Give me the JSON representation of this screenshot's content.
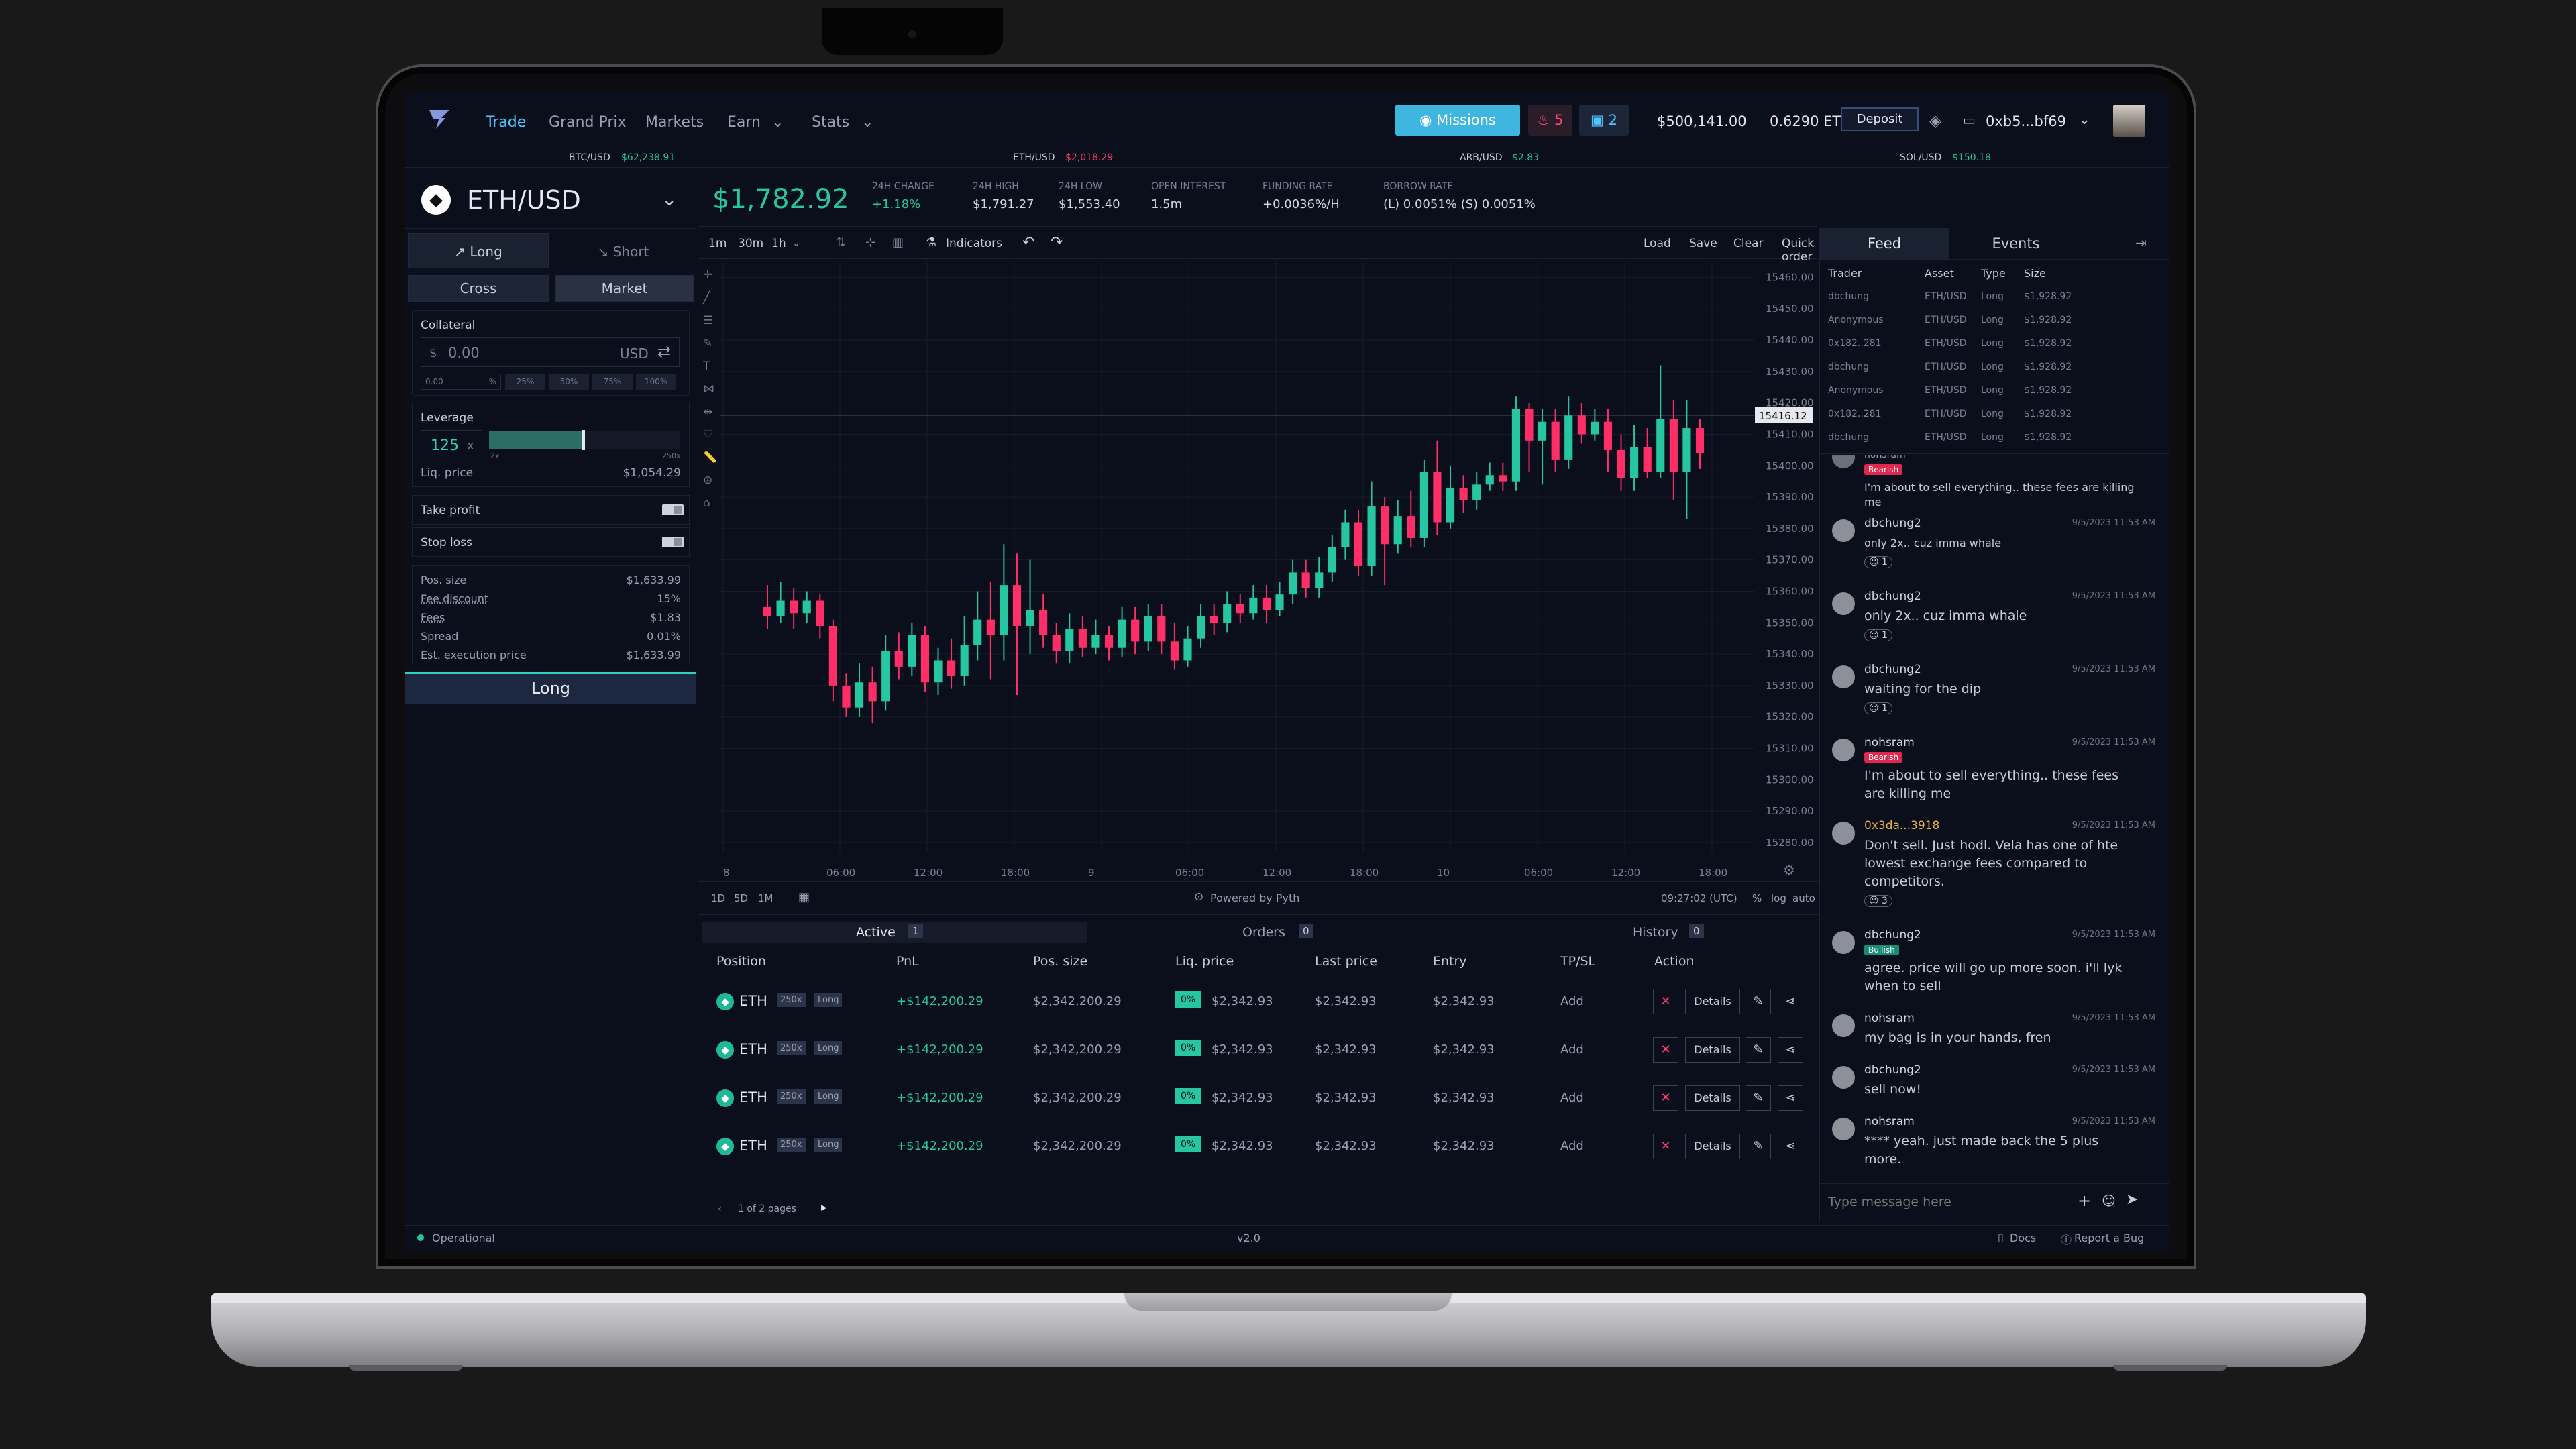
{
  "nav": {
    "links": [
      "Trade",
      "Grand Prix",
      "Markets",
      "Earn",
      "Stats"
    ],
    "missions_label": "Missions",
    "fire_count": "5",
    "box_count": "2",
    "balance_usd": "$500,141.00",
    "balance_eth": "0.6290 ETH",
    "deposit_label": "Deposit",
    "wallet": "0xb5...bf69"
  },
  "ticker": [
    {
      "pair": "BTC/USD",
      "price": "$62,238.91",
      "color": "#26c6a0"
    },
    {
      "pair": "ETH/USD",
      "price": "$2,018.29",
      "color": "#ff3b6b"
    },
    {
      "pair": "ARB/USD",
      "price": "$2.83",
      "color": "#26c6a0"
    },
    {
      "pair": "SOL/USD",
      "price": "$150.18",
      "color": "#26c6a0"
    }
  ],
  "market": {
    "pair": "ETH/USD",
    "price": "$1,782.92",
    "stats": [
      {
        "label": "24H CHANGE",
        "value": "+1.18%",
        "color": "#26c6a0"
      },
      {
        "label": "24H HIGH",
        "value": "$1,791.27",
        "color": "#d4d7df"
      },
      {
        "label": "24H LOW",
        "value": "$1,553.40",
        "color": "#d4d7df"
      },
      {
        "label": "OPEN INTEREST",
        "value": "1.5m",
        "color": "#d4d7df"
      },
      {
        "label": "FUNDING RATE",
        "value": "+0.0036%/H",
        "color": "#d4d7df"
      },
      {
        "label": "BORROW RATE",
        "value": "(L) 0.0051% (S) 0.0051%",
        "color": "#d4d7df"
      }
    ]
  },
  "order": {
    "long_label": "Long",
    "short_label": "Short",
    "cross_label": "Cross",
    "market_label": "Market",
    "collateral_label": "Collateral",
    "collateral_value": "0.00",
    "currency_symbol": "$",
    "currency": "USD",
    "pct_input": "0.00",
    "pct_sign": "%",
    "pct_options": [
      "25%",
      "50%",
      "75%",
      "100%"
    ],
    "leverage_label": "Leverage",
    "leverage_value": "125",
    "leverage_x": "x",
    "lev_min": "2x",
    "lev_max": "250x",
    "liq_label": "Liq. price",
    "liq_value": "$1,054.29",
    "take_profit": "Take profit",
    "stop_loss": "Stop loss",
    "summary": [
      {
        "label": "Pos. size",
        "value": "$1,633.99"
      },
      {
        "label": "Fee discount",
        "value": "15%"
      },
      {
        "label": "Fees",
        "value": "$1.83"
      },
      {
        "label": "Spread",
        "value": "0.01%"
      },
      {
        "label": "Est. execution price",
        "value": "$1,633.99"
      }
    ],
    "submit_label": "Long"
  },
  "toolbar": {
    "intervals": [
      "1m",
      "30m",
      "1h"
    ],
    "indicators_label": "Indicators",
    "load": "Load",
    "save": "Save",
    "clear": "Clear",
    "quick_order": "Quick order"
  },
  "chart_data": {
    "type": "candlestick",
    "y_ticks": [
      15460,
      15450,
      15440,
      15430,
      15420,
      15410,
      15400,
      15390,
      15380,
      15370,
      15360,
      15350,
      15340,
      15330,
      15320,
      15310,
      15300,
      15290,
      15280
    ],
    "ylim": [
      15277,
      15465
    ],
    "x_ticks": [
      "8",
      "06:00",
      "12:00",
      "18:00",
      "9",
      "06:00",
      "12:00",
      "18:00",
      "10",
      "06:00",
      "12:00",
      "18:00"
    ],
    "last_price": "15416.12",
    "last_value": 15416.12,
    "candles": [
      [
        15355,
        15352,
        15362,
        15348
      ],
      [
        15352,
        15357,
        15363,
        15350
      ],
      [
        15357,
        15353,
        15361,
        15348
      ],
      [
        15353,
        15357,
        15360,
        15350
      ],
      [
        15357,
        15349,
        15359,
        15345
      ],
      [
        15349,
        15330,
        15351,
        15325
      ],
      [
        15330,
        15323,
        15334,
        15320
      ],
      [
        15323,
        15331,
        15337,
        15320
      ],
      [
        15331,
        15325,
        15336,
        15318
      ],
      [
        15325,
        15341,
        15346,
        15322
      ],
      [
        15341,
        15336,
        15347,
        15332
      ],
      [
        15336,
        15346,
        15350,
        15333
      ],
      [
        15346,
        15331,
        15349,
        15328
      ],
      [
        15331,
        15338,
        15342,
        15327
      ],
      [
        15338,
        15333,
        15345,
        15329
      ],
      [
        15333,
        15343,
        15352,
        15330
      ],
      [
        15343,
        15351,
        15360,
        15338
      ],
      [
        15351,
        15346,
        15363,
        15332
      ],
      [
        15346,
        15362,
        15375,
        15338
      ],
      [
        15362,
        15349,
        15372,
        15327
      ],
      [
        15349,
        15354,
        15370,
        15340
      ],
      [
        15354,
        15346,
        15359,
        15342
      ],
      [
        15346,
        15341,
        15350,
        15337
      ],
      [
        15341,
        15348,
        15353,
        15337
      ],
      [
        15348,
        15342,
        15352,
        15339
      ],
      [
        15342,
        15346,
        15351,
        15340
      ],
      [
        15346,
        15342,
        15349,
        15338
      ],
      [
        15342,
        15351,
        15355,
        15339
      ],
      [
        15351,
        15344,
        15355,
        15340
      ],
      [
        15344,
        15352,
        15356,
        15341
      ],
      [
        15352,
        15344,
        15356,
        15340
      ],
      [
        15344,
        15338,
        15350,
        15335
      ],
      [
        15338,
        15345,
        15349,
        15336
      ],
      [
        15345,
        15352,
        15356,
        15342
      ],
      [
        15352,
        15350,
        15356,
        15346
      ],
      [
        15350,
        15356,
        15360,
        15347
      ],
      [
        15356,
        15353,
        15359,
        15350
      ],
      [
        15353,
        15358,
        15362,
        15351
      ],
      [
        15358,
        15354,
        15362,
        15350
      ],
      [
        15354,
        15359,
        15363,
        15352
      ],
      [
        15359,
        15366,
        15370,
        15356
      ],
      [
        15366,
        15361,
        15370,
        15358
      ],
      [
        15361,
        15366,
        15371,
        15358
      ],
      [
        15366,
        15374,
        15378,
        15363
      ],
      [
        15374,
        15382,
        15386,
        15370
      ],
      [
        15382,
        15368,
        15386,
        15365
      ],
      [
        15368,
        15387,
        15395,
        15365
      ],
      [
        15387,
        15375,
        15390,
        15362
      ],
      [
        15375,
        15384,
        15389,
        15372
      ],
      [
        15384,
        15377,
        15392,
        15374
      ],
      [
        15377,
        15398,
        15402,
        15374
      ],
      [
        15398,
        15382,
        15408,
        15378
      ],
      [
        15382,
        15393,
        15400,
        15380
      ],
      [
        15393,
        15389,
        15397,
        15385
      ],
      [
        15389,
        15394,
        15398,
        15386
      ],
      [
        15394,
        15397,
        15401,
        15392
      ],
      [
        15397,
        15395,
        15401,
        15392
      ],
      [
        15395,
        15418,
        15422,
        15392
      ],
      [
        15418,
        15408,
        15420,
        15398
      ],
      [
        15408,
        15414,
        15418,
        15394
      ],
      [
        15414,
        15402,
        15418,
        15398
      ],
      [
        15402,
        15416,
        15422,
        15399
      ],
      [
        15416,
        15410,
        15420,
        15407
      ],
      [
        15410,
        15414,
        15418,
        15408
      ],
      [
        15414,
        15405,
        15418,
        15398
      ],
      [
        15405,
        15396,
        15410,
        15392
      ],
      [
        15396,
        15406,
        15413,
        15392
      ],
      [
        15406,
        15398,
        15412,
        15396
      ],
      [
        15398,
        15415,
        15432,
        15396
      ],
      [
        15415,
        15398,
        15421,
        15389
      ],
      [
        15398,
        15412,
        15421,
        15383
      ],
      [
        15412,
        15404,
        15415,
        15399
      ]
    ]
  },
  "chart_footer": {
    "ranges": [
      "1D",
      "5D",
      "1M"
    ],
    "powered": "Powered by Pyth",
    "clock": "09:27:02 (UTC)",
    "pct": "%",
    "log": "log",
    "auto": "auto"
  },
  "positions": {
    "tabs": [
      {
        "label": "Active",
        "count": "1"
      },
      {
        "label": "Orders",
        "count": "0"
      },
      {
        "label": "History",
        "count": "0"
      }
    ],
    "headers": [
      "Position",
      "PnL",
      "Pos. size",
      "Liq. price",
      "Last price",
      "Entry",
      "TP/SL",
      "Action"
    ],
    "rows": [
      {
        "asset": "ETH",
        "lev": "250x",
        "side": "Long",
        "pnl": "+$142,200.29",
        "size": "$2,342,200.29",
        "liq_pct": "0%",
        "liq": "$2,342.93",
        "last": "$2,342.93",
        "entry": "$2,342.93",
        "tpsl": "Add",
        "details": "Details"
      },
      {
        "asset": "ETH",
        "lev": "250x",
        "side": "Long",
        "pnl": "+$142,200.29",
        "size": "$2,342,200.29",
        "liq_pct": "0%",
        "liq": "$2,342.93",
        "last": "$2,342.93",
        "entry": "$2,342.93",
        "tpsl": "Add",
        "details": "Details"
      },
      {
        "asset": "ETH",
        "lev": "250x",
        "side": "Long",
        "pnl": "+$142,200.29",
        "size": "$2,342,200.29",
        "liq_pct": "0%",
        "liq": "$2,342.93",
        "last": "$2,342.93",
        "entry": "$2,342.93",
        "tpsl": "Add",
        "details": "Details"
      },
      {
        "asset": "ETH",
        "lev": "250x",
        "side": "Long",
        "pnl": "+$142,200.29",
        "size": "$2,342,200.29",
        "liq_pct": "0%",
        "liq": "$2,342.93",
        "last": "$2,342.93",
        "entry": "$2,342.93",
        "tpsl": "Add",
        "details": "Details"
      }
    ],
    "pagination": "1 of 2 pages"
  },
  "feed": {
    "tabs": [
      "Feed",
      "Events"
    ],
    "headers": [
      "Trader",
      "Asset",
      "Type",
      "Size"
    ],
    "rows": [
      [
        "dbchung",
        "ETH/USD",
        "Long",
        "$1,928.92"
      ],
      [
        "Anonymous",
        "ETH/USD",
        "Long",
        "$1,928.92"
      ],
      [
        "0x182..281",
        "ETH/USD",
        "Long",
        "$1,928.92"
      ],
      [
        "dbchung",
        "ETH/USD",
        "Long",
        "$1,928.92"
      ],
      [
        "Anonymous",
        "ETH/USD",
        "Long",
        "$1,928.92"
      ],
      [
        "0x182..281",
        "ETH/USD",
        "Long",
        "$1,928.92"
      ],
      [
        "dbchung",
        "ETH/USD",
        "Long",
        "$1,928.92"
      ]
    ]
  },
  "chat": {
    "partial": {
      "name": "nohsram",
      "badge": "Bearish",
      "text": "I'm about to sell everything.. these fees are killing me"
    },
    "messages": [
      {
        "name": "dbchung2",
        "time": "9/5/2023 11:53 AM",
        "text": "only 2x.. cuz imma whale",
        "react": "1",
        "small": true
      },
      {
        "name": "dbchung2",
        "time": "9/5/2023 11:53 AM",
        "text": "only 2x.. cuz imma whale",
        "react": "1"
      },
      {
        "name": "dbchung2",
        "time": "9/5/2023 11:53 AM",
        "text": "waiting for the dip",
        "react": "1"
      },
      {
        "name": "nohsram",
        "time": "9/5/2023 11:53 AM",
        "badge": "Bearish",
        "text": "I'm about to sell everything.. these fees are killing me"
      },
      {
        "name": "0x3da...3918",
        "time": "9/5/2023 11:53 AM",
        "text": "Don't sell. Just hodl. Vela has one of hte lowest exchange fees compared to competitors.",
        "react": "3",
        "gold": true
      },
      {
        "name": "dbchung2",
        "time": "9/5/2023 11:53 AM",
        "badge": "Bullish",
        "text": "agree. price will go up more soon. i'll lyk when to sell"
      },
      {
        "name": "nohsram",
        "time": "9/5/2023 11:53 AM",
        "text": "my bag is in your hands, fren"
      },
      {
        "name": "dbchung2",
        "time": "9/5/2023 11:53 AM",
        "text": "sell now!"
      },
      {
        "name": "nohsram",
        "time": "9/5/2023 11:53 AM",
        "text": "**** yeah. just made back the 5 plus more."
      }
    ],
    "placeholder": "Type message here"
  },
  "footer": {
    "status": "Operational",
    "version": "v2.0",
    "docs": "Docs",
    "bug": "Report a Bug"
  }
}
